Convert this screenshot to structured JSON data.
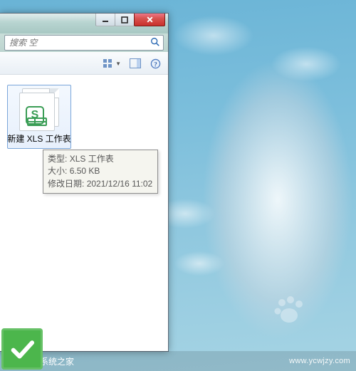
{
  "window": {
    "controls": {
      "minimize": "minimize",
      "maximize": "maximize",
      "close": "close"
    }
  },
  "search": {
    "placeholder": "搜索 空"
  },
  "toolbar": {
    "view": "view-options",
    "preview": "preview-pane",
    "help": "help"
  },
  "file": {
    "label": "新建 XLS 工作表",
    "icon": "wps-spreadsheet"
  },
  "tooltip": {
    "type_key": "类型",
    "type_value": "XLS 工作表",
    "size_key": "大小",
    "size_value": "6.50 KB",
    "modified_key": "修改日期",
    "modified_value": "2021/12/16 11:02"
  },
  "brand": {
    "name": "纯净系统之家",
    "url": "www.ycwjzy.com"
  }
}
